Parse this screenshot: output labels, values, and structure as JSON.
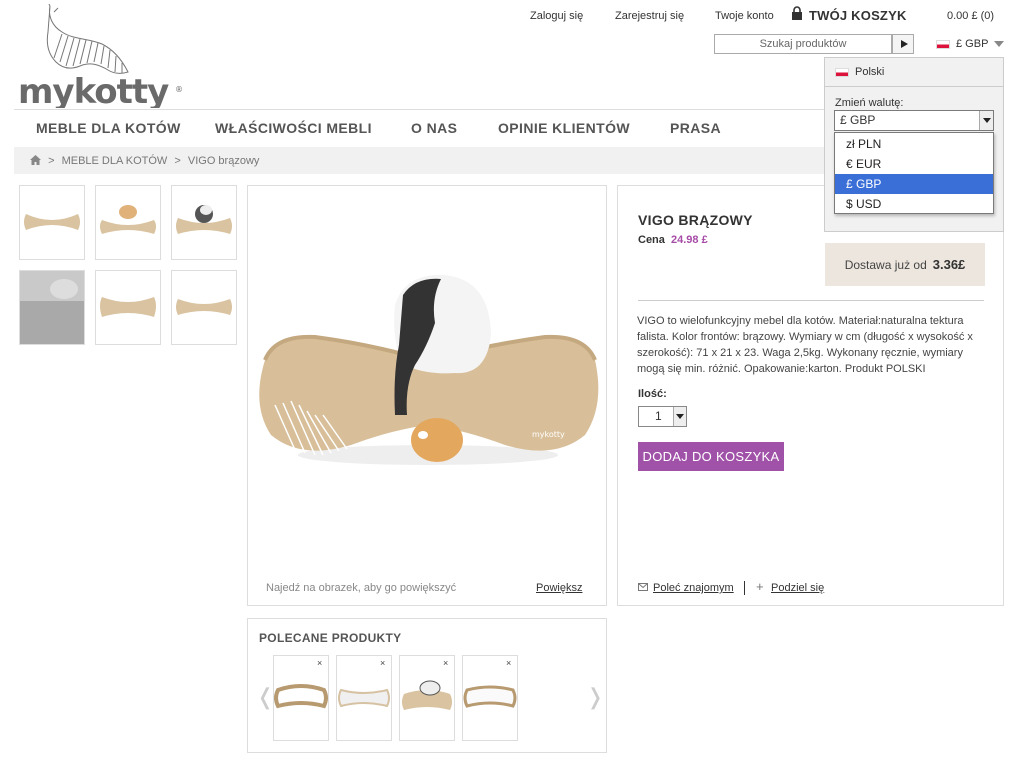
{
  "brand": {
    "logo_text": "mykotty"
  },
  "header": {
    "login": "Zaloguj się",
    "register": "Zarejestruj się",
    "account": "Twoje konto",
    "cart_label": "TWÓJ KOSZYK",
    "cart_total": "0.00 £ (0)",
    "search_placeholder": "Szukaj produktów",
    "currency_current": "£ GBP"
  },
  "currency_panel": {
    "language": "Polski",
    "change_label": "Zmień walutę:",
    "selected": "£ GBP",
    "options": [
      "zł PLN",
      "€ EUR",
      "£ GBP",
      "$ USD"
    ],
    "highlighted_index": 2
  },
  "nav": {
    "items": [
      "MEBLE DLA KOTÓW",
      "WŁAŚCIWOŚCI MEBLI",
      "O NAS",
      "OPINIE KLIENTÓW",
      "PRASA"
    ]
  },
  "breadcrumb": {
    "sep": ">",
    "items": [
      "MEBLE DLA KOTÓW",
      "VIGO brązowy"
    ]
  },
  "gallery": {
    "hint": "Najedź na obrazek, aby go powiększyć",
    "zoom": "Powiększ"
  },
  "product": {
    "title": "VIGO BRĄZOWY",
    "price_label": "Cena",
    "price": "24.98 £",
    "shipping_label": "Dostawa już od",
    "shipping_price": "3.36£",
    "description": "VIGO to wielofunkcyjny mebel dla kotów. Materiał:naturalna tektura falista. Kolor frontów: brązowy. Wymiary w cm (długość x wysokość x szerokość): 71 x 21 x 23. Waga 2,5kg. Wykonany ręcznie, wymiary mogą się min. różnić. Opakowanie:karton. Produkt POLSKI",
    "qty_label": "Ilość:",
    "qty_value": "1",
    "add_to_cart": "DODAJ DO KOSZYKA",
    "recommend": "Poleć znajomym",
    "share": "Podziel się"
  },
  "recommended": {
    "title": "POLECANE PRODUKTY",
    "close_glyph": "×",
    "prev_glyph": "❬",
    "next_glyph": "❭"
  },
  "colors": {
    "accent": "#a052a8",
    "price": "#a64ca6",
    "shipping_bg": "#ece6de",
    "dropdown_highlight": "#3a6fd8"
  }
}
